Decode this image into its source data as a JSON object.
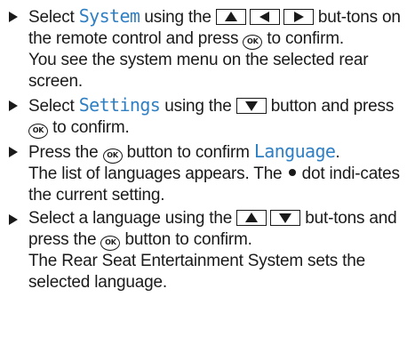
{
  "colors": {
    "highlight": "#2f7fc4",
    "text": "#1a1a1a"
  },
  "icons": {
    "bullet": "right-triangle-bullet",
    "up": "up-arrow-button",
    "down": "down-arrow-button",
    "left": "left-arrow-button",
    "right": "right-arrow-button",
    "ok": "ok-button",
    "dot": "filled-dot"
  },
  "ok_label": "OK",
  "steps": [
    {
      "t1": "Select ",
      "hl": "System",
      "t2": " using the ",
      "t3": " but-tons on the remote control and press ",
      "t4": " to confirm.",
      "result": "You see the system menu on the selected rear screen."
    },
    {
      "t1": "Select ",
      "hl": "Settings",
      "t2": " using the ",
      "t3": " button and press ",
      "t4": " to confirm."
    },
    {
      "t1": "Press the ",
      "t2": " button to confirm ",
      "hl": "Language",
      "t3": ".",
      "r1": "The list of languages appears. The ",
      "r2": " dot indi-cates the current setting."
    },
    {
      "t1": "Select a language using the ",
      "t2": " but-tons and press the ",
      "t3": " button to confirm.",
      "result": "The Rear Seat Entertainment System sets the selected language."
    }
  ]
}
